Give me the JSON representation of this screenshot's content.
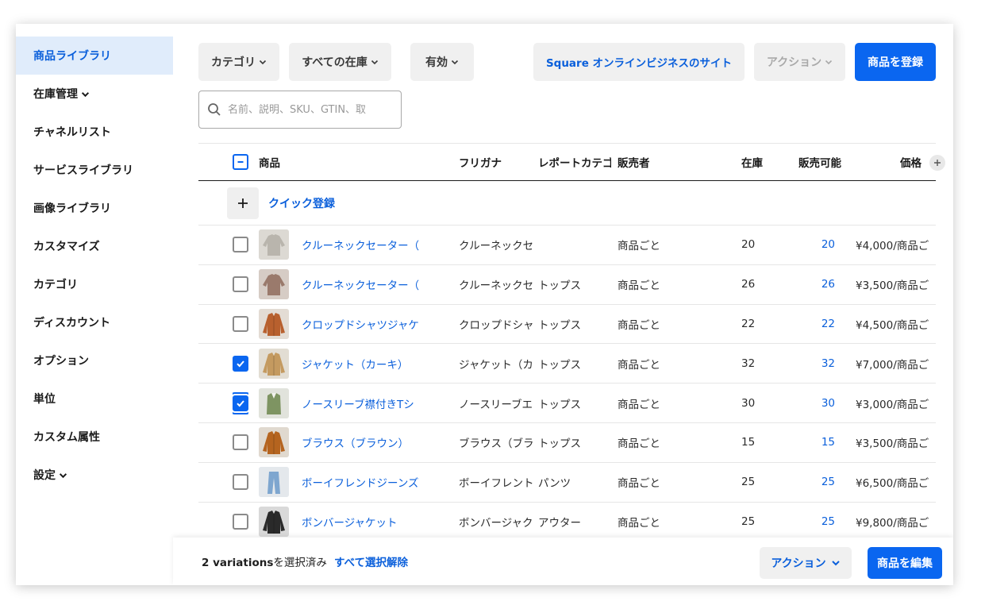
{
  "sidebar": {
    "items": [
      {
        "label": "商品ライブラリ",
        "active": true
      },
      {
        "label": "在庫管理",
        "chevron": true
      },
      {
        "label": "チャネルリスト"
      },
      {
        "label": "サービスライブラリ"
      },
      {
        "label": "画像ライブラリ"
      },
      {
        "label": "カスタマイズ"
      },
      {
        "label": "カテゴリ"
      },
      {
        "label": "ディスカウント"
      },
      {
        "label": "オプション"
      },
      {
        "label": "単位"
      },
      {
        "label": "カスタム属性"
      },
      {
        "label": "設定",
        "chevron": true
      }
    ]
  },
  "toolbar": {
    "category_label": "カテゴリ",
    "stock_label": "すべての在庫",
    "active_label": "有効",
    "site_label": "Square オンラインビジネスのサイト",
    "action_label": "アクション",
    "register_label": "商品を登録"
  },
  "search": {
    "placeholder": "名前、説明、SKU、GTIN、取",
    "value": ""
  },
  "table": {
    "headers": {
      "product": "商品",
      "furigana": "フリガナ",
      "report_category": "レポートカテゴ",
      "seller": "販売者",
      "stock": "在庫",
      "available": "販売可能",
      "price": "価格"
    },
    "quick_add_label": "クイック登録",
    "rows": [
      {
        "name": "クルーネックセーター（",
        "furigana": "クルーネックセ",
        "category": "",
        "seller": "商品ごと",
        "stock": "20",
        "available": "20",
        "price": "¥4,000/商品ご",
        "checked": false
      },
      {
        "name": "クルーネックセーター（",
        "furigana": "クルーネックセ",
        "category": "トップス",
        "seller": "商品ごと",
        "stock": "26",
        "available": "26",
        "price": "¥3,500/商品ご",
        "checked": false
      },
      {
        "name": "クロップドシャツジャケ",
        "furigana": "クロップドシャ",
        "category": "トップス",
        "seller": "商品ごと",
        "stock": "22",
        "available": "22",
        "price": "¥4,500/商品ご",
        "checked": false
      },
      {
        "name": "ジャケット（カーキ）",
        "furigana": "ジャケット（カ",
        "category": "トップス",
        "seller": "商品ごと",
        "stock": "32",
        "available": "32",
        "price": "¥7,000/商品ご",
        "checked": true
      },
      {
        "name": "ノースリーブ襟付きTシ",
        "furigana": "ノースリーブエ",
        "category": "トップス",
        "seller": "商品ごと",
        "stock": "30",
        "available": "30",
        "price": "¥3,000/商品ご",
        "checked": true
      },
      {
        "name": "ブラウス（ブラウン）",
        "furigana": "ブラウス（ブラ",
        "category": "トップス",
        "seller": "商品ごと",
        "stock": "15",
        "available": "15",
        "price": "¥3,500/商品ご",
        "checked": false
      },
      {
        "name": "ボーイフレンドジーンズ",
        "furigana": "ボーイフレント",
        "category": "パンツ",
        "seller": "商品ごと",
        "stock": "25",
        "available": "25",
        "price": "¥6,500/商品ご",
        "checked": false
      },
      {
        "name": "ボンバージャケット",
        "furigana": "ボンバージャク",
        "category": "アウター",
        "seller": "商品ごと",
        "stock": "25",
        "available": "25",
        "price": "¥9,800/商品ご",
        "checked": false
      }
    ]
  },
  "footer": {
    "count_strong": "2 variations",
    "count_rest": "を選択済み",
    "clear_label": "すべて選択解除",
    "action_label": "アクション",
    "edit_label": "商品を編集"
  },
  "colors": {
    "accent": "#0a66f0",
    "link": "#0a5fdb",
    "active_nav_bg": "#e0ecfb"
  }
}
